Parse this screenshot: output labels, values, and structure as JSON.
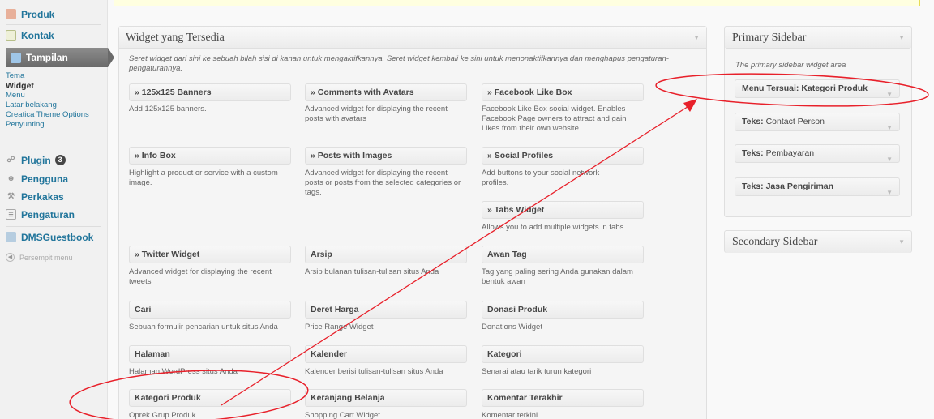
{
  "admin_menu": {
    "produk": "Produk",
    "kontak": "Kontak",
    "tampilan": "Tampilan",
    "submenu": [
      "Tema",
      "Widget",
      "Menu",
      "Latar belakang",
      "Creatica Theme Options",
      "Penyunting"
    ],
    "plugin": "Plugin",
    "plugin_badge": "3",
    "pengguna": "Pengguna",
    "perkakas": "Perkakas",
    "pengaturan": "Pengaturan",
    "dmsguestbook": "DMSGuestbook",
    "collapse": "Persempit menu"
  },
  "available": {
    "title": "Widget yang Tersedia",
    "description": "Seret widget dari sini ke sebuah bilah sisi di kanan untuk mengaktifkannya. Seret widget kembali ke sini untuk menonaktifkannya dan menghapus pengaturan-pengaturannya.",
    "widgets": [
      {
        "title": "» 125x125 Banners",
        "desc": "Add 125x125 banners."
      },
      {
        "title": "» Comments with Avatars",
        "desc": "Advanced widget for displaying the recent posts with avatars"
      },
      {
        "title": "» Facebook Like Box",
        "desc": "Facebook Like Box social widget. Enables Facebook Page owners to attract and gain Likes from their own website."
      },
      {
        "title": "» Info Box",
        "desc": "Highlight a product or service with a custom image."
      },
      {
        "title": "» Posts with Images",
        "desc": "Advanced widget for displaying the recent posts or posts from the selected categories or tags."
      },
      {
        "title": "» Social Profiles",
        "desc": "Add buttons to your social network profiles."
      },
      {
        "title": "» Tabs Widget",
        "desc": "Allows you to add multiple widgets in tabs."
      },
      {
        "title": "» Twitter Widget",
        "desc": "Advanced widget for displaying the recent tweets"
      },
      {
        "title": "Arsip",
        "desc": "Arsip bulanan tulisan-tulisan situs Anda"
      },
      {
        "title": "Awan Tag",
        "desc": "Tag yang paling sering Anda gunakan dalam bentuk awan"
      },
      {
        "title": "Cari",
        "desc": "Sebuah formulir pencarian untuk situs Anda"
      },
      {
        "title": "Deret Harga",
        "desc": "Price Range Widget"
      },
      {
        "title": "Donasi Produk",
        "desc": "Donations Widget"
      },
      {
        "title": "Halaman",
        "desc": "Halaman WordPress situs Anda"
      },
      {
        "title": "Kalender",
        "desc": "Kalender berisi tulisan-tulisan situs Anda"
      },
      {
        "title": "Kategori",
        "desc": "Senarai atau tarik turun kategori"
      },
      {
        "title": "Kategori Produk",
        "desc": "Oprek Grup Produk"
      },
      {
        "title": "Keranjang Belanja",
        "desc": "Shopping Cart Widget"
      },
      {
        "title": "Komentar Terakhir",
        "desc": "Komentar terkini"
      }
    ]
  },
  "primary": {
    "title": "Primary Sidebar",
    "description": "The primary sidebar widget area",
    "widgets": [
      {
        "prefix": "Menu Tersuai:",
        "name": "Kategori Produk"
      },
      {
        "prefix": "Teks:",
        "name": "Contact Person"
      },
      {
        "prefix": "Teks:",
        "name": "Pembayaran"
      },
      {
        "prefix": "Teks:",
        "name": "Jasa Pengiriman"
      }
    ]
  },
  "secondary": {
    "title": "Secondary Sidebar"
  },
  "colors": {
    "link": "#21759b",
    "annotation": "#e8202a"
  },
  "icons": {
    "toggle": "triangle-down-icon"
  }
}
